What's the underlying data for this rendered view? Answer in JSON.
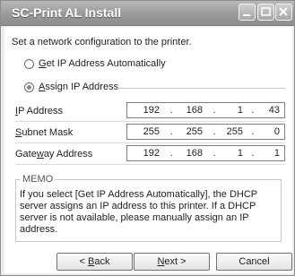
{
  "window": {
    "title": "SC-Print AL Install"
  },
  "intro": "Set a network configuration to the printer.",
  "options": {
    "auto": {
      "label": "Get IP Address Automatically",
      "selected": false
    },
    "assign": {
      "label": "Assign IP Address",
      "selected": true
    }
  },
  "fields": {
    "ip": {
      "label": "IP Address",
      "octets": [
        "192",
        "168",
        "1",
        "43"
      ]
    },
    "subnet": {
      "label": "Subnet Mask",
      "octets": [
        "255",
        "255",
        "255",
        "0"
      ]
    },
    "gateway": {
      "label": "Gateway Address",
      "octets": [
        "192",
        "168",
        "1",
        "1"
      ]
    }
  },
  "memo": {
    "title": "MEMO",
    "text": "If you select [Get IP Address Automatically], the DHCP server assigns an IP address to this printer. If a DHCP server is not available, please manually assign an IP address."
  },
  "buttons": {
    "back": "< Back",
    "next": "Next >",
    "cancel": "Cancel"
  }
}
